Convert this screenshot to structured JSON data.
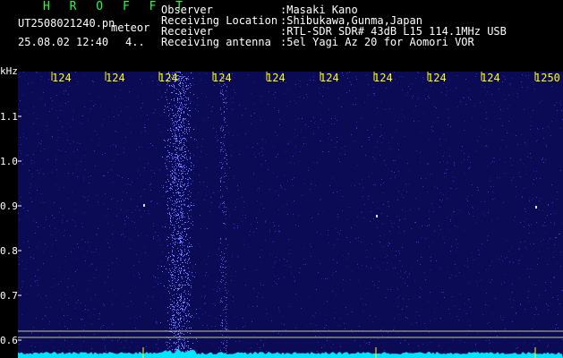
{
  "header": {
    "title": "H R O F F T",
    "filename": "UT2508021240.pn",
    "mode": "meteor",
    "datetime": "25.08.02 12:40",
    "count": "4..",
    "fields": [
      {
        "label": "Observer",
        "value": ":Masaki Kano"
      },
      {
        "label": "Receiving Location",
        "value": ":Shibukawa,Gunma,Japan"
      },
      {
        "label": "Receiver",
        "value": ":RTL-SDR SDR# 43dB L15 114.1MHz USB"
      },
      {
        "label": "Receiving antenna",
        "value": ":5el Yagi Az 20 for Aomori VOR"
      }
    ]
  },
  "axes": {
    "y_unit": "kHz",
    "x_ticks": [
      "124",
      "124",
      "124",
      "124",
      "124",
      "124",
      "124",
      "124",
      "124",
      "1250"
    ],
    "y_ticks": [
      "1.1",
      "1.0",
      "0.9",
      "0.8",
      "0.7",
      "0.6"
    ]
  },
  "colors": {
    "background": "#000000",
    "plot": "#0a0a55",
    "title": "#22ff44",
    "tick": "#ffff00",
    "signal": "#00e5ff"
  }
}
